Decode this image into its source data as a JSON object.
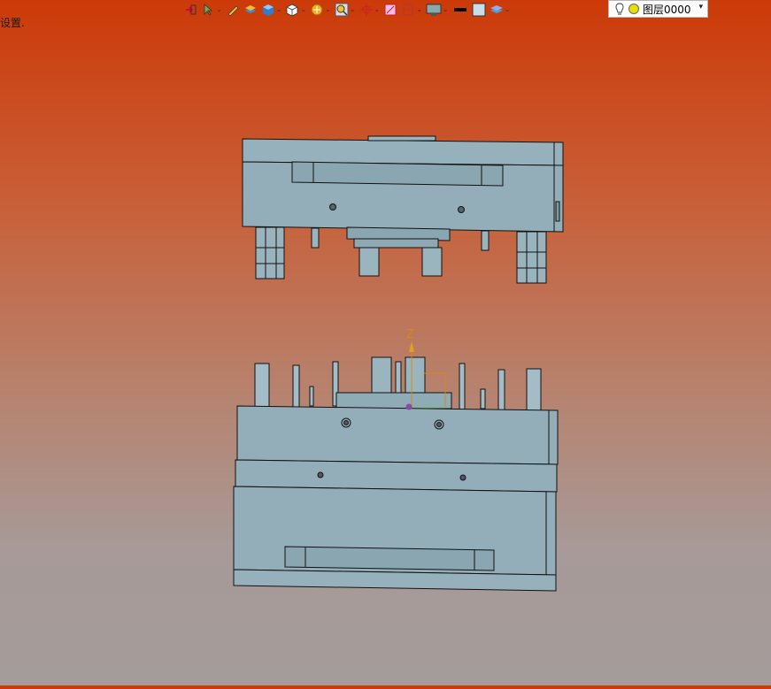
{
  "status": {
    "message": "设置."
  },
  "toolbar": {
    "items": [
      {
        "icon": "snap-icon",
        "dropdown": false
      },
      {
        "icon": "select-filter-icon",
        "dropdown": true
      },
      {
        "icon": "pencil-icon",
        "dropdown": false
      },
      {
        "icon": "layer-box-icon",
        "dropdown": false
      },
      {
        "icon": "solid-cube-icon",
        "dropdown": true
      },
      {
        "icon": "view-cube-icon",
        "dropdown": true
      },
      {
        "icon": "render-icon",
        "dropdown": true
      },
      {
        "icon": "zoom-icon",
        "dropdown": true
      },
      {
        "icon": "origin-icon",
        "dropdown": true
      },
      {
        "icon": "section-icon",
        "dropdown": false
      },
      {
        "icon": "clip-icon",
        "dropdown": true
      },
      {
        "icon": "display-icon",
        "dropdown": true
      },
      {
        "icon": "line-color-icon",
        "dropdown": false
      },
      {
        "icon": "fill-color-icon",
        "dropdown": false
      },
      {
        "icon": "layer-stack-icon",
        "dropdown": true
      }
    ]
  },
  "layer": {
    "current": "图层0000"
  },
  "axis": {
    "z_label": "Z"
  },
  "colors": {
    "part": "#93aeb8",
    "part_dark": "#7f9aa4",
    "edge": "#111111",
    "axis": "#d08a18"
  }
}
